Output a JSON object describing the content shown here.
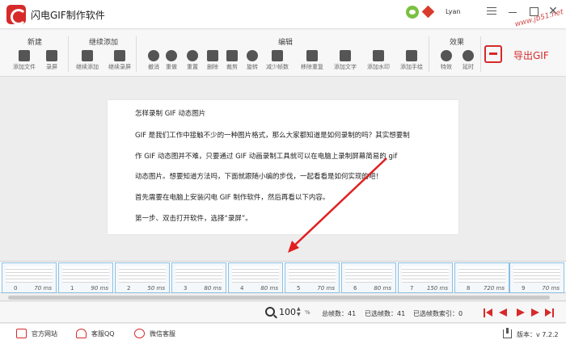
{
  "app": {
    "title": "闪电GIF制作软件",
    "username": "Lyan",
    "watermark": "www.jb51.net"
  },
  "toolbar": {
    "groups": [
      {
        "label": "新建"
      },
      {
        "label": "继续添加"
      },
      {
        "label": "编辑"
      },
      {
        "label": "效果"
      }
    ],
    "tools": [
      {
        "label": "添加文件",
        "icon": "file-icon"
      },
      {
        "label": "录屏",
        "icon": "video-camera-icon"
      },
      {
        "label": "继续添加",
        "icon": "file-icon"
      },
      {
        "label": "继续录屏",
        "icon": "video-camera-icon"
      },
      {
        "label": "撤消",
        "icon": "undo-icon"
      },
      {
        "label": "重做",
        "icon": "redo-icon"
      },
      {
        "label": "重置",
        "icon": "reset-icon"
      },
      {
        "label": "删除",
        "icon": "trash-icon"
      },
      {
        "label": "裁剪",
        "icon": "crop-icon"
      },
      {
        "label": "旋转",
        "icon": "rotate-icon"
      },
      {
        "label": "减少帧数",
        "icon": "reduce-frames-icon"
      },
      {
        "label": "移除重复",
        "icon": "remove-duplicates-icon"
      },
      {
        "label": "添加文字",
        "icon": "text-icon"
      },
      {
        "label": "添加水印",
        "icon": "watermark-icon"
      },
      {
        "label": "添加手绘",
        "icon": "brush-icon"
      },
      {
        "label": "特效",
        "icon": "effects-icon"
      },
      {
        "label": "延时",
        "icon": "timer-icon"
      }
    ],
    "export_label": "导出GIF"
  },
  "document": {
    "lines": [
      "怎样录制 GIF 动态图片",
      "GIF 是我们工作中接触不少的一种图片格式，那么大家都知道是如何录制的吗？其实想要制",
      "作 GIF 动态图并不难，只要通过 GIF 动画录制工具就可以在电脑上录制屏幕简易的 gif",
      "动态图片。想要知道方法吗，下面就跟随小编的步伐，一起看看是如何实现的吧！",
      "首先需要在电脑上安装闪电 GIF 制作软件，然后再看以下内容。",
      "第一步、双击打开软件，选择“录屏”。"
    ]
  },
  "frames": [
    {
      "index": "0",
      "delay": "70 ms"
    },
    {
      "index": "1",
      "delay": "90 ms"
    },
    {
      "index": "2",
      "delay": "50 ms"
    },
    {
      "index": "3",
      "delay": "80 ms"
    },
    {
      "index": "4",
      "delay": "80 ms"
    },
    {
      "index": "5",
      "delay": "70 ms"
    },
    {
      "index": "6",
      "delay": "80 ms"
    },
    {
      "index": "7",
      "delay": "150 ms"
    },
    {
      "index": "8",
      "delay": "720 ms"
    },
    {
      "index": "9",
      "delay": "70 ms"
    }
  ],
  "status": {
    "zoom": "100",
    "zoom_unit": "%",
    "total_frames": "总帧数：41",
    "selected_frames": "已选帧数：41",
    "selected_index": "已选帧数索引：0"
  },
  "footer": {
    "official_site": "官方网站",
    "support_qq": "客服QQ",
    "wechat_support": "微信客服",
    "version": "版本：v 7.2.2"
  },
  "colors": {
    "accent": "#d62a2a",
    "frame_border": "#8bbfe3",
    "arrow": "#e02020"
  }
}
